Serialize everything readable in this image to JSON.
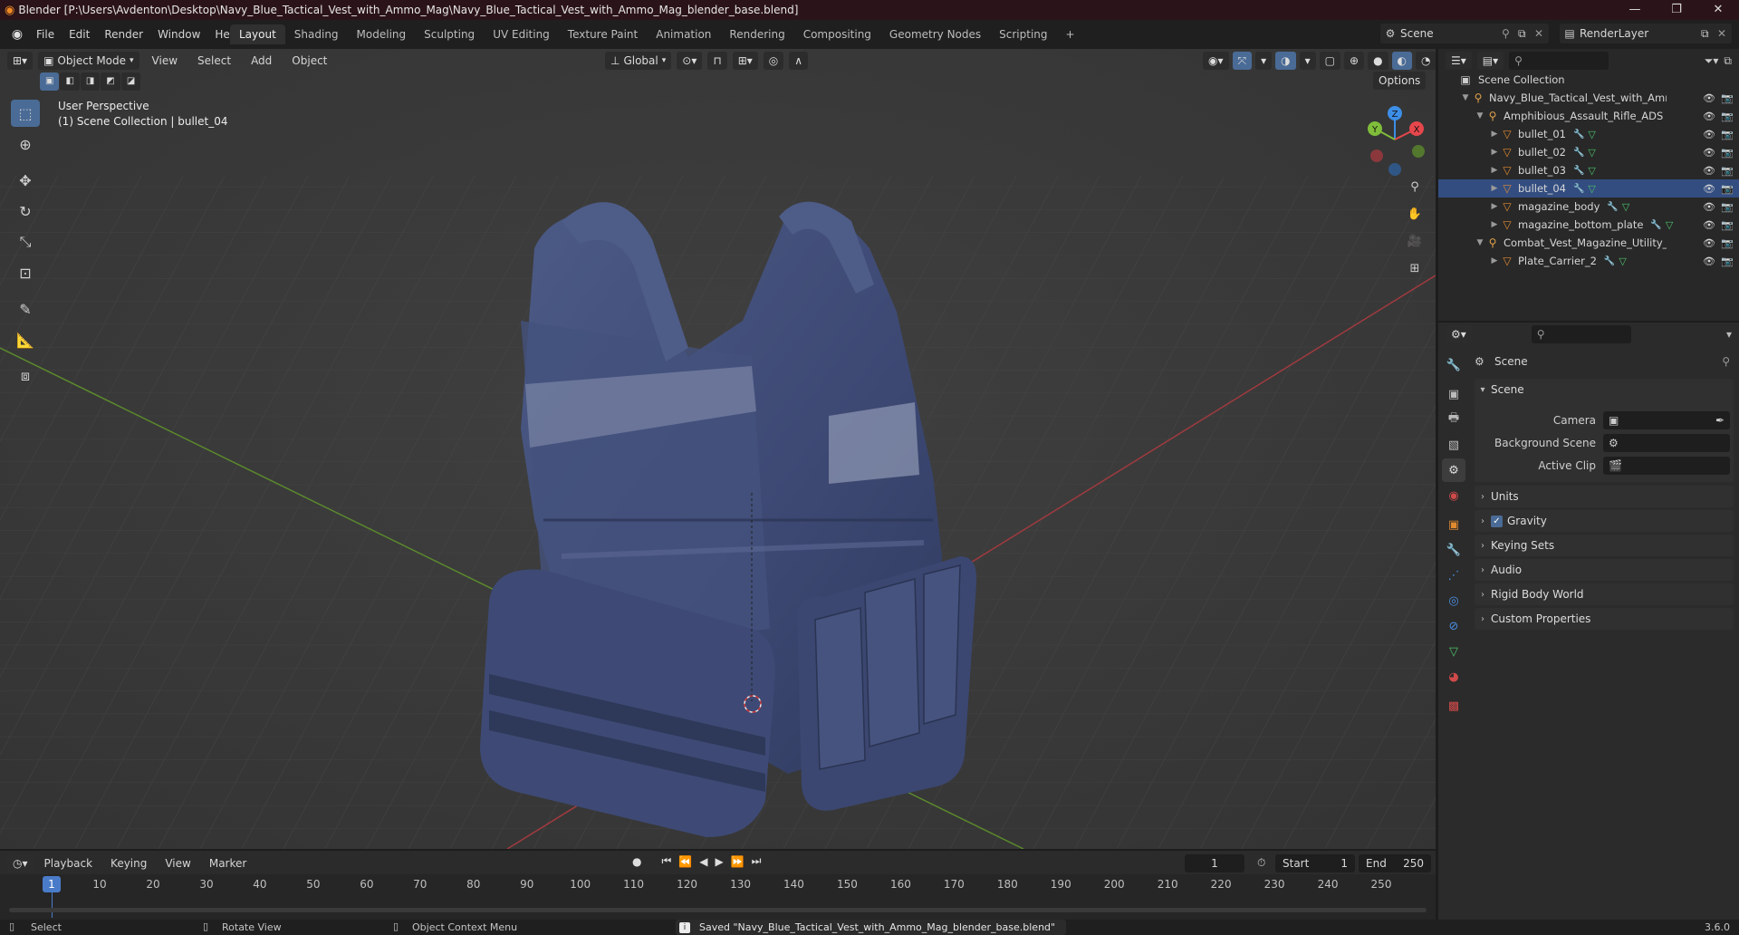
{
  "window": {
    "title": "Blender [P:\\Users\\Avdenton\\Desktop\\Navy_Blue_Tactical_Vest_with_Ammo_Mag\\Navy_Blue_Tactical_Vest_with_Ammo_Mag_blender_base.blend]",
    "minimize": "—",
    "maximize": "❐",
    "close": "✕"
  },
  "menu": {
    "file": "File",
    "edit": "Edit",
    "render": "Render",
    "window": "Window",
    "help": "Help"
  },
  "workspaces": [
    "Layout",
    "Shading",
    "Modeling",
    "Sculpting",
    "UV Editing",
    "Texture Paint",
    "Animation",
    "Rendering",
    "Compositing",
    "Geometry Nodes",
    "Scripting"
  ],
  "workspace_add": "+",
  "scene_selector": {
    "label": "Scene"
  },
  "renderlayer_selector": {
    "label": "RenderLayer"
  },
  "viewport": {
    "mode": "Object Mode",
    "menus": {
      "view": "View",
      "select": "Select",
      "add": "Add",
      "object": "Object"
    },
    "orientation": "Global",
    "options": "Options",
    "overlay_title": "User Perspective",
    "overlay_sub": "(1) Scene Collection | bullet_04",
    "axes": {
      "x": "X",
      "y": "Y",
      "z": "Z"
    }
  },
  "outliner": {
    "root": "Scene Collection",
    "rows": [
      {
        "label": "Navy_Blue_Tactical_Vest_with_Ammo_I",
        "indent": 1,
        "type": "collection",
        "expanded": true
      },
      {
        "label": "Amphibious_Assault_Rifle_ADS",
        "indent": 2,
        "type": "collection",
        "expanded": true
      },
      {
        "label": "bullet_01",
        "indent": 3,
        "type": "mesh"
      },
      {
        "label": "bullet_02",
        "indent": 3,
        "type": "mesh"
      },
      {
        "label": "bullet_03",
        "indent": 3,
        "type": "mesh"
      },
      {
        "label": "bullet_04",
        "indent": 3,
        "type": "mesh",
        "active": true
      },
      {
        "label": "magazine_body",
        "indent": 3,
        "type": "mesh"
      },
      {
        "label": "magazine_bottom_plate",
        "indent": 3,
        "type": "mesh"
      },
      {
        "label": "Combat_Vest_Magazine_Utility_Bla",
        "indent": 2,
        "type": "collection",
        "expanded": true
      },
      {
        "label": "Plate_Carrier_2",
        "indent": 3,
        "type": "mesh"
      }
    ]
  },
  "properties": {
    "context": "Scene",
    "panel_title": "Scene",
    "fields": {
      "camera": "Camera",
      "background_scene": "Background Scene",
      "active_clip": "Active Clip"
    },
    "panels": [
      "Units",
      "Gravity",
      "Keying Sets",
      "Audio",
      "Rigid Body World",
      "Custom Properties"
    ],
    "gravity_enabled": true
  },
  "timeline": {
    "menus": {
      "playback": "Playback",
      "keying": "Keying",
      "view": "View",
      "marker": "Marker"
    },
    "current_frame": "1",
    "start_label": "Start",
    "start": "1",
    "end_label": "End",
    "end": "250",
    "ticks": [
      "1",
      "10",
      "20",
      "30",
      "40",
      "50",
      "60",
      "70",
      "80",
      "90",
      "100",
      "110",
      "120",
      "130",
      "140",
      "150",
      "160",
      "170",
      "180",
      "190",
      "200",
      "210",
      "220",
      "230",
      "240",
      "250"
    ]
  },
  "status": {
    "select": "Select",
    "rotate": "Rotate View",
    "context_menu": "Object Context Menu",
    "message": "Saved \"Navy_Blue_Tactical_Vest_with_Ammo_Mag_blender_base.blend\"",
    "version": "3.6.0"
  },
  "colors": {
    "accent": "#4a6b96",
    "selection": "#334d80",
    "axis_x": "#e6474c",
    "axis_y": "#7fbd3a",
    "axis_z": "#3d8ee6",
    "vest": "#3f4d78"
  }
}
